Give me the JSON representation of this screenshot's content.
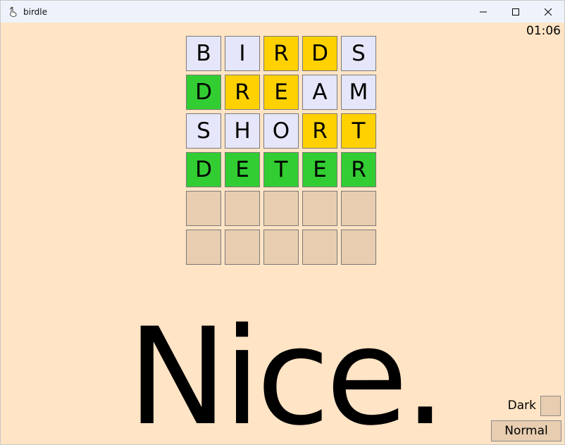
{
  "window": {
    "title": "birdle",
    "icon": "goose-icon",
    "controls": [
      "minimize-icon",
      "maximize-icon",
      "close-icon"
    ]
  },
  "timer": "01:06",
  "board": {
    "rows": [
      {
        "letters": [
          "B",
          "I",
          "R",
          "D",
          "S"
        ],
        "states": [
          "absent",
          "absent",
          "present",
          "present",
          "absent"
        ]
      },
      {
        "letters": [
          "D",
          "R",
          "E",
          "A",
          "M"
        ],
        "states": [
          "correct",
          "present",
          "present",
          "absent",
          "absent"
        ]
      },
      {
        "letters": [
          "S",
          "H",
          "O",
          "R",
          "T"
        ],
        "states": [
          "absent",
          "absent",
          "absent",
          "present",
          "present"
        ]
      },
      {
        "letters": [
          "D",
          "E",
          "T",
          "E",
          "R"
        ],
        "states": [
          "correct",
          "correct",
          "correct",
          "correct",
          "correct"
        ]
      },
      {
        "letters": [
          "",
          "",
          "",
          "",
          ""
        ],
        "states": [
          "empty",
          "empty",
          "empty",
          "empty",
          "empty"
        ]
      },
      {
        "letters": [
          "",
          "",
          "",
          "",
          ""
        ],
        "states": [
          "empty",
          "empty",
          "empty",
          "empty",
          "empty"
        ]
      }
    ]
  },
  "message": "Nice.",
  "settings": {
    "dark_label": "Dark",
    "mode_button_label": "Normal"
  },
  "colors": {
    "background": "#ffe4c5",
    "absent": "#e6e6fa",
    "present": "#ffd100",
    "correct": "#32cd32",
    "empty": "#e8cdb0",
    "titlebar": "#eef3fb"
  }
}
